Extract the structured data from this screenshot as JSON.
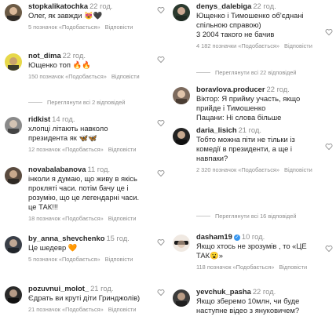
{
  "left": [
    {
      "user": "stopkalikatochka",
      "time": "22 год.",
      "text": "Олег, як завжди 😻🖤",
      "likes": "5 позначок «Подобається»",
      "reply": "Відповісти"
    },
    {
      "user": "not_dima",
      "time": "22 год.",
      "text": "Ющенко топ 🔥🔥",
      "likes": "150 позначок «Подобається»",
      "reply": "Відповісти",
      "replies": "Переглянути всі 2 відповідей"
    },
    {
      "user": "ridkist",
      "time": "14 год.",
      "text": "хлопці літають навколо\nпрезидента як 🦋🦋",
      "likes": "12 позначок «Подобається»",
      "reply": "Відповісти"
    },
    {
      "user": "novabalabanova",
      "time": "11 год.",
      "text": "інколи я думаю, що живу в якісь\nпрокляті часи. потім бачу це і\nрозумію, що це легендарні часи.\nце ТАК!!!",
      "likes": "18 позначок «Подобається»",
      "reply": "Відповісти"
    },
    {
      "user": "by_anna_shevchenko",
      "time": "15 год.",
      "text": "Це шедевр 🧡",
      "likes": "5 позначок «Подобається»",
      "reply": "Відповісти"
    },
    {
      "user": "pozuvnui_molot_",
      "time": "21 год.",
      "text": "Єдрать ви круті діти Гриндж​олів)",
      "likes": "21 позначок «Подобається»",
      "reply": "Відповісти"
    }
  ],
  "right": [
    {
      "user": "denys_dalebiga",
      "time": "22 год.",
      "verified": "",
      "text": "Ющенко і Тимошенко об'єднані\nспільною справою)\n3 2004 такого не бачив",
      "likes": "4 182 позначки «Подобається»",
      "reply": "Відповісти",
      "replies": "Переглянути всі 22 відповідей"
    },
    {
      "user": "boravlova.producer",
      "time": "22 год.",
      "text": "Віктор: Я прийму участь, якщо\nприйде і Тимошенко\nПацани: Ні слова більше",
      "likes": "",
      "reply": ""
    },
    {
      "user": "daria_lisich",
      "time": "21 год.",
      "text": "Тобто можна піти не тільки із\nкомедії в президенти, а ще і\nнавпаки?",
      "likes": "2 320 позначок «Подобається»",
      "reply": "Відповісти",
      "replies": "Переглянути всі 16 відповідей"
    },
    {
      "user": "dasham19",
      "verified": "✓",
      "time": "10 год.",
      "text": "Якщо хтось не зрозумів , то «ЦЕ\nТАК😮»",
      "likes": "118 позначок «Подобається»",
      "reply": "Відповісти"
    },
    {
      "user": "yevchuk_pasha",
      "time": "22 год.",
      "text": "Якщо зберемо 10млн, чи буде\nнаступне відео з януковичем?",
      "likes": "",
      "reply": ""
    }
  ],
  "colors": {
    "username": "#262626",
    "muted": "#8e8e8e",
    "verified": "#3897f0"
  }
}
